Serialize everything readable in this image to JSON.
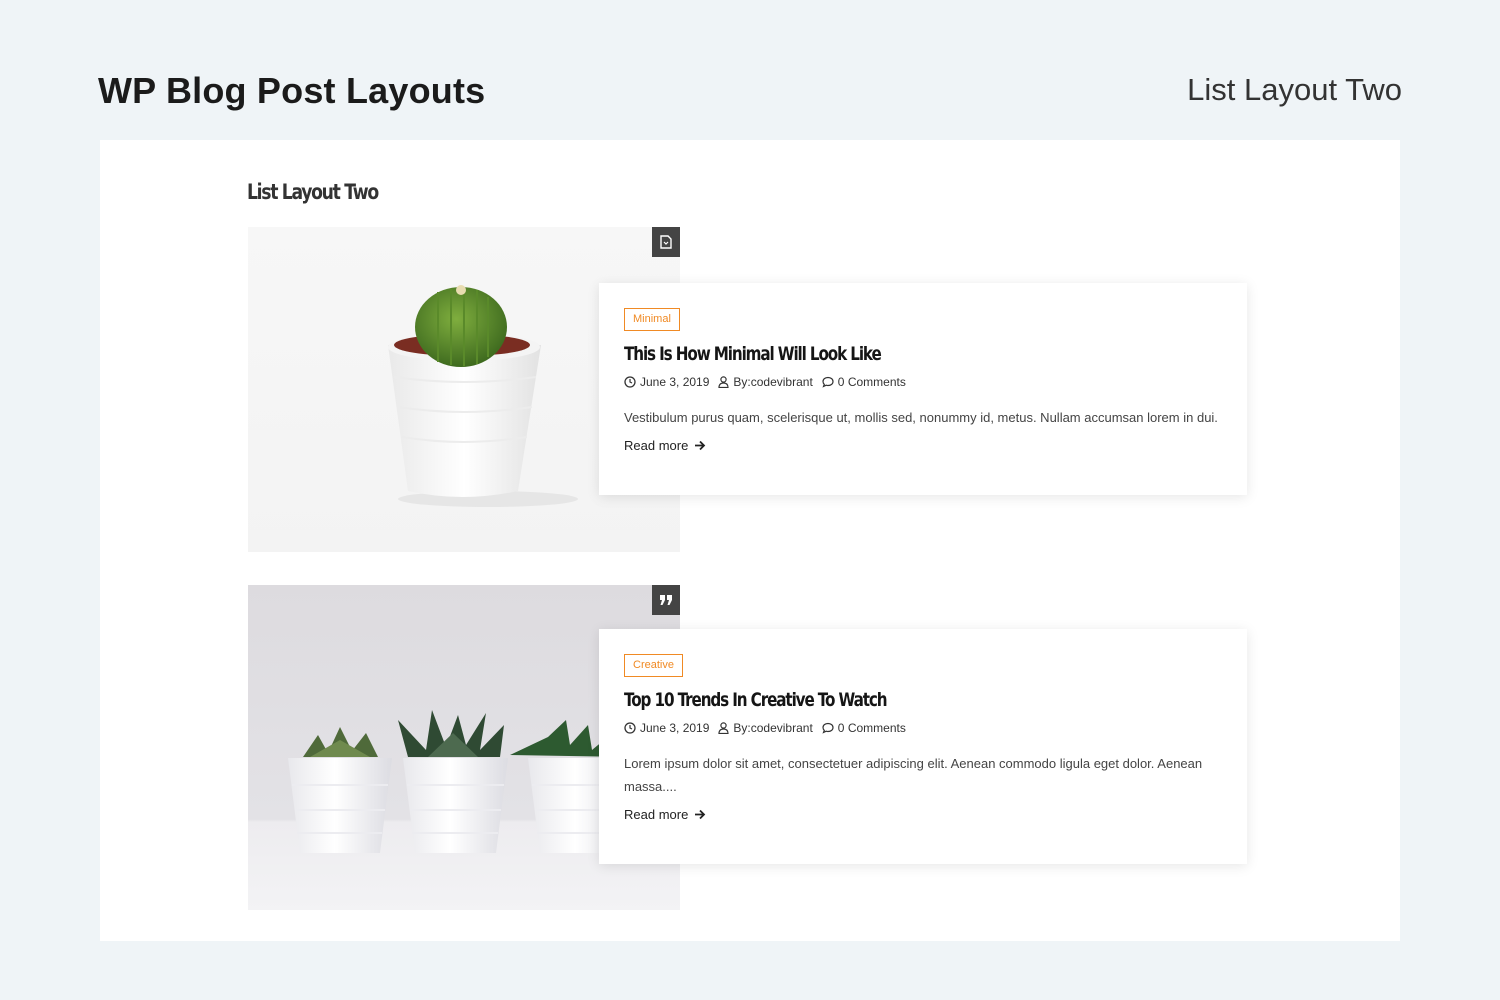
{
  "header": {
    "title": "WP Blog Post Layouts",
    "subtitle": "List Layout Two"
  },
  "section": {
    "heading": "List Layout Two"
  },
  "posts": [
    {
      "format_icon": "document-icon",
      "image": "single-cactus-in-white-pot",
      "category": "Minimal",
      "title": "This Is How Minimal Will Look Like",
      "date": "June 3, 2019",
      "author": "By:codevibrant",
      "comments": "0",
      "comments_label": "Comments",
      "excerpt": "Vestibulum purus quam, scelerisque ut, mollis sed, nonummy id, metus. Nullam accumsan lorem in dui.",
      "read_more": "Read more"
    },
    {
      "format_icon": "quote-icon",
      "image": "three-succulents-in-white-pots",
      "category": "Creative",
      "title": "Top 10 Trends In Creative To Watch",
      "date": "June 3, 2019",
      "author": "By:codevibrant",
      "comments": "0",
      "comments_label": "Comments",
      "excerpt": "Lorem ipsum dolor sit amet, consectetuer adipiscing elit. Aenean commodo ligula eget dolor. Aenean massa....",
      "read_more": "Read more"
    }
  ],
  "colors": {
    "background": "#eff4f7",
    "accent": "#f08a24",
    "badge": "#444444"
  }
}
